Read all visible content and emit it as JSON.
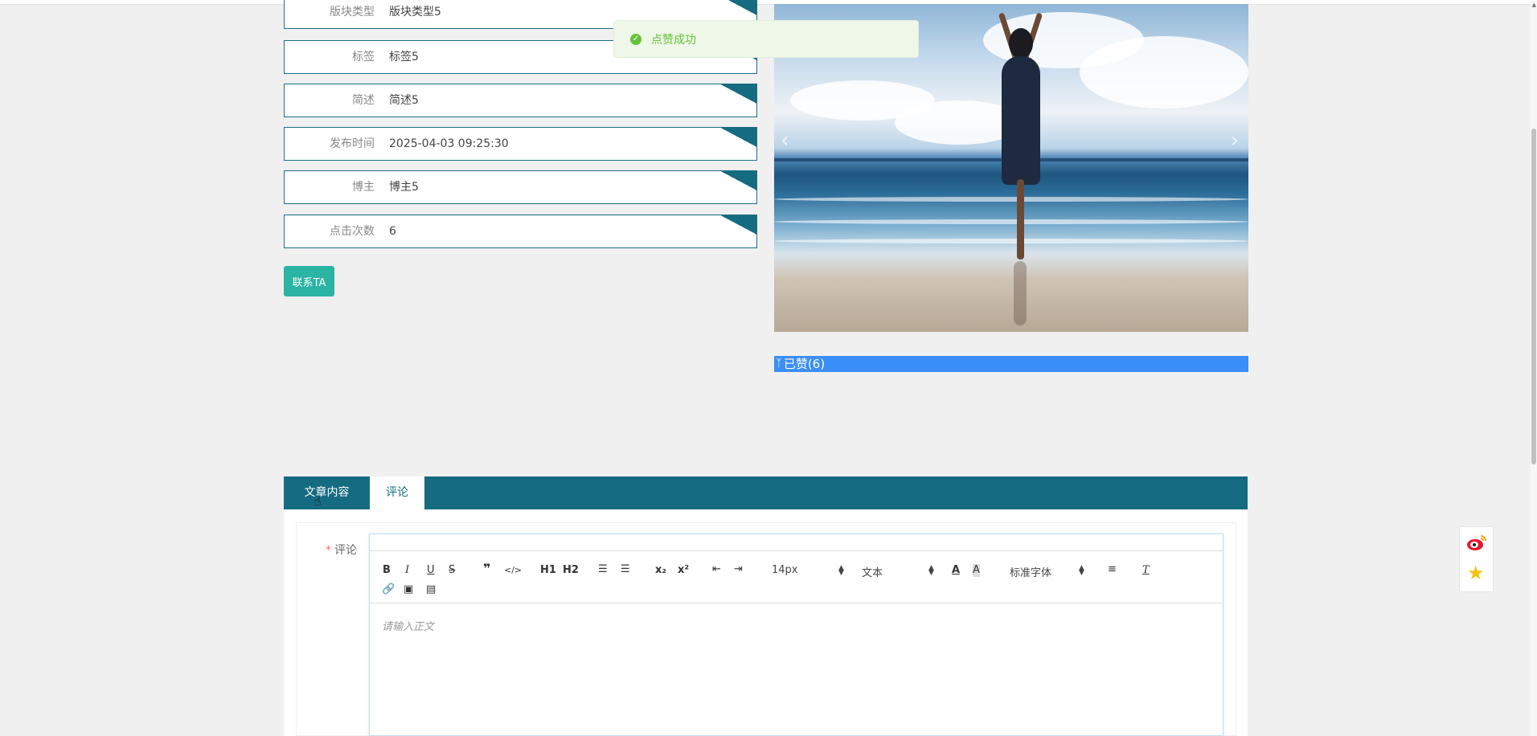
{
  "toast": {
    "message": "点赞成功",
    "icon": "check-circle-icon"
  },
  "details": [
    {
      "label": "版块类型",
      "value": "版块类型5"
    },
    {
      "label": "标签",
      "value": "标签5"
    },
    {
      "label": "简述",
      "value": "简述5"
    },
    {
      "label": "发布时间",
      "value": "2025-04-03 09:25:30"
    },
    {
      "label": "博主",
      "value": "博主5"
    },
    {
      "label": "点击次数",
      "value": "6"
    }
  ],
  "contact_button": "联系TA",
  "like": {
    "icon": "thumb-icon",
    "label": "已赞(6)"
  },
  "tabs": [
    {
      "label": "文章内容"
    },
    {
      "label": "评论"
    }
  ],
  "comment_form": {
    "required_mark": "*",
    "label": "评论",
    "placeholder": "请输入正文",
    "toolbar": {
      "font_size": "14px",
      "block_type": "文本",
      "font_family": "标准字体",
      "h1": "H1",
      "h2": "H2"
    }
  },
  "colors": {
    "primary": "#156b80",
    "button": "#2bb3a4",
    "like_bar": "#3a8ef7",
    "success": "#67c23a"
  }
}
